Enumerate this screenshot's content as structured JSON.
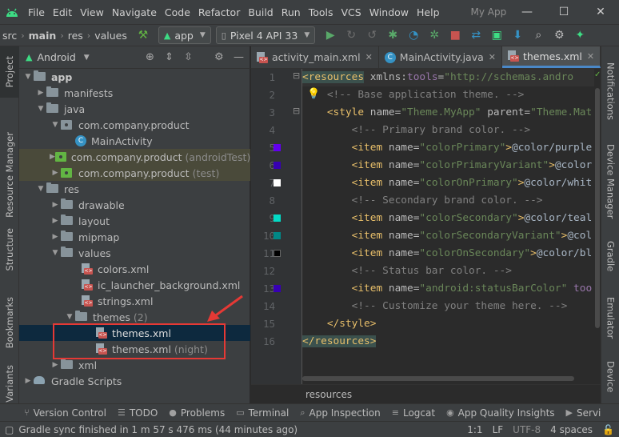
{
  "menubar": {
    "items": [
      "File",
      "Edit",
      "View",
      "Navigate",
      "Code",
      "Refactor",
      "Build",
      "Run",
      "Tools",
      "VCS",
      "Window",
      "Help"
    ],
    "app_title": "My App",
    "minimize": "—",
    "maximize": "☐",
    "close": "✕"
  },
  "navbar": {
    "breadcrumbs": [
      "src",
      "main",
      "res",
      "values"
    ],
    "run_config": "app",
    "device": "Pixel 4 API 33"
  },
  "left_stripe": [
    "Project",
    "Resource Manager",
    "Structure",
    "Bookmarks",
    "Variants"
  ],
  "right_stripe": [
    "Notifications",
    "Device Manager",
    "Gradle",
    "Emulator",
    "Device"
  ],
  "project": {
    "view_mode": "Android",
    "tree": [
      {
        "label": "app",
        "muted": ""
      },
      {
        "label": "manifests",
        "muted": ""
      },
      {
        "label": "java",
        "muted": ""
      },
      {
        "label": "com.company.product",
        "muted": ""
      },
      {
        "label": "MainActivity",
        "muted": ""
      },
      {
        "label": "com.company.product",
        "muted": "(androidTest)"
      },
      {
        "label": "com.company.product",
        "muted": "(test)"
      },
      {
        "label": "res",
        "muted": ""
      },
      {
        "label": "drawable",
        "muted": ""
      },
      {
        "label": "layout",
        "muted": ""
      },
      {
        "label": "mipmap",
        "muted": ""
      },
      {
        "label": "values",
        "muted": ""
      },
      {
        "label": "colors.xml",
        "muted": ""
      },
      {
        "label": "ic_launcher_background.xml",
        "muted": ""
      },
      {
        "label": "strings.xml",
        "muted": ""
      },
      {
        "label": "themes",
        "muted": "(2)"
      },
      {
        "label": "themes.xml",
        "muted": ""
      },
      {
        "label": "themes.xml",
        "muted": "(night)"
      },
      {
        "label": "xml",
        "muted": ""
      },
      {
        "label": "Gradle Scripts",
        "muted": ""
      }
    ]
  },
  "tabs": [
    {
      "label": "activity_main.xml"
    },
    {
      "label": "MainActivity.java"
    },
    {
      "label": "themes.xml"
    }
  ],
  "editor": {
    "line_numbers": [
      "1",
      "2",
      "3",
      "4",
      "5",
      "6",
      "7",
      "8",
      "9",
      "10",
      "11",
      "12",
      "13",
      "14",
      "15",
      "16"
    ],
    "swatch_colors": {
      "l5": "#6200ee",
      "l6": "#3700b3",
      "l7": "#ffffff",
      "l9": "#03dac5",
      "l10": "#018786",
      "l11": "#000000",
      "l13": "#3700b3"
    },
    "breadcrumb": "resources"
  },
  "bottom_tools": [
    "Version Control",
    "TODO",
    "Problems",
    "Terminal",
    "App Inspection",
    "Logcat",
    "App Quality Insights",
    "Servi"
  ],
  "status": {
    "message": "Gradle sync finished in 1 m 57 s 476 ms (44 minutes ago)",
    "position": "1:1",
    "line_sep": "LF",
    "encoding": "UTF-8",
    "indent": "4 spaces"
  },
  "colors": {
    "accent": "#4a88c7",
    "selection": "#0d293e",
    "annotation": "#e53935"
  }
}
